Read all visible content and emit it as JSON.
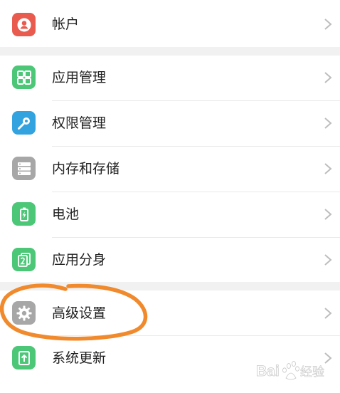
{
  "settings": {
    "account": {
      "label": "帐户",
      "icon": "account-icon"
    },
    "apps": {
      "label": "应用管理",
      "icon": "app-grid-icon"
    },
    "permissions": {
      "label": "权限管理",
      "icon": "key-icon"
    },
    "storage": {
      "label": "内存和存储",
      "icon": "storage-icon"
    },
    "battery": {
      "label": "电池",
      "icon": "battery-icon"
    },
    "clone": {
      "label": "应用分身",
      "icon": "app-clone-icon"
    },
    "advanced": {
      "label": "高级设置",
      "icon": "gear-icon"
    },
    "update": {
      "label": "系统更新",
      "icon": "system-update-icon"
    }
  },
  "watermark": {
    "text": "Bai 经验"
  },
  "colors": {
    "account": "#ea5b4f",
    "apps": "#4cc778",
    "permissions": "#33a3e0",
    "storage": "#a7a7a7",
    "battery": "#4cc778",
    "clone": "#4cc778",
    "advanced": "#a7a7a7",
    "update": "#4cc778",
    "highlight": "#f08a2c"
  }
}
